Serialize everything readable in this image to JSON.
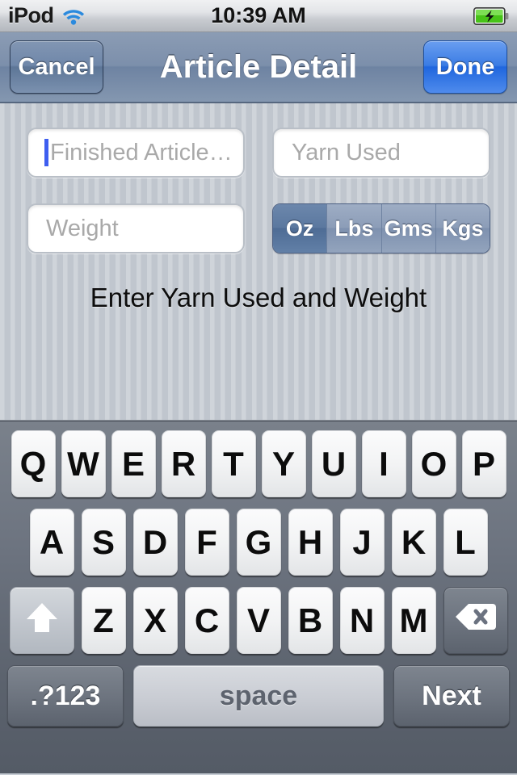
{
  "status_bar": {
    "carrier": "iPod",
    "wifi_icon": "wifi-icon",
    "time": "10:39 AM",
    "battery_icon": "battery-charging-icon"
  },
  "nav_bar": {
    "cancel_label": "Cancel",
    "title": "Article Detail",
    "done_label": "Done"
  },
  "form": {
    "article_field": {
      "placeholder": "Finished Article…",
      "value": "",
      "focused": true
    },
    "yarn_field": {
      "placeholder": "Yarn Used",
      "value": ""
    },
    "weight_field": {
      "placeholder": "Weight",
      "value": ""
    },
    "units_segmented": {
      "options": [
        "Oz",
        "Lbs",
        "Gms",
        "Kgs"
      ],
      "selected": "Oz"
    },
    "hint": "Enter Yarn Used and Weight"
  },
  "keyboard": {
    "row1": [
      "Q",
      "W",
      "E",
      "R",
      "T",
      "Y",
      "U",
      "I",
      "O",
      "P"
    ],
    "row2": [
      "A",
      "S",
      "D",
      "F",
      "G",
      "H",
      "J",
      "K",
      "L"
    ],
    "row3": [
      "Z",
      "X",
      "C",
      "V",
      "B",
      "N",
      "M"
    ],
    "shift_icon": "shift-arrow-icon",
    "backspace_icon": "backspace-icon",
    "numbers_label": ".?123",
    "space_label": "space",
    "return_label": "Next"
  },
  "colors": {
    "accent_blue": "#2f6fe0",
    "caret_blue": "#3e5ef0",
    "nav_bar": "#7c8fab",
    "content_bg": "#c3c9d1",
    "keyboard_bg": "#6d7480",
    "battery_green": "#5ec62a"
  }
}
